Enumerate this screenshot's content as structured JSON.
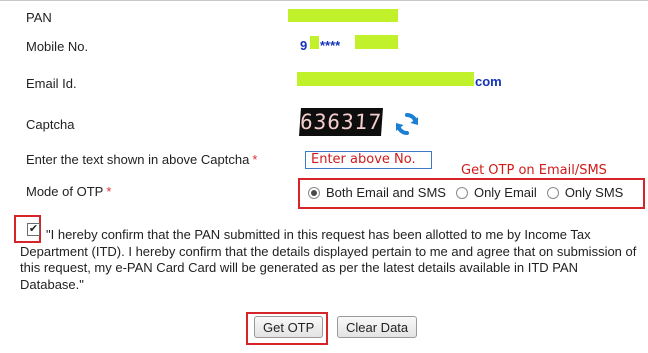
{
  "form": {
    "pan_label": "PAN",
    "mobile_label": "Mobile No.",
    "mobile_value_prefix": "9",
    "mobile_value_mask": "****",
    "email_label": "Email Id.",
    "email_domain": "com",
    "captcha_label": "Captcha",
    "captcha_text": "636317",
    "captcha_input_label": "Enter the text shown in above Captcha",
    "captcha_input_value": "Enter above No.",
    "otp_mode_label": "Mode of OTP",
    "required_mark": "*",
    "otp_options": [
      {
        "label": "Both Email and SMS",
        "checked": true
      },
      {
        "label": "Only Email",
        "checked": false
      },
      {
        "label": "Only SMS",
        "checked": false
      }
    ],
    "declaration": "\"I hereby confirm that the PAN submitted in this request has been allotted to me by Income Tax Department (ITD). I hereby confirm that the details displayed pertain to me and agree that on submission of this request, my e-PAN Card Card will be generated as per the latest details available in ITD PAN Database.\"",
    "declaration_checked": true
  },
  "annotations": {
    "otp_note": "Get OTP on Email/SMS"
  },
  "buttons": {
    "get_otp": "Get OTP",
    "clear_data": "Clear Data"
  },
  "colors": {
    "redaction": "#c1f12b",
    "annotation_red": "#d6252a",
    "value_blue": "#1433b8"
  },
  "icons": {
    "refresh": "refresh-icon",
    "checkmark": "checkmark-icon"
  }
}
